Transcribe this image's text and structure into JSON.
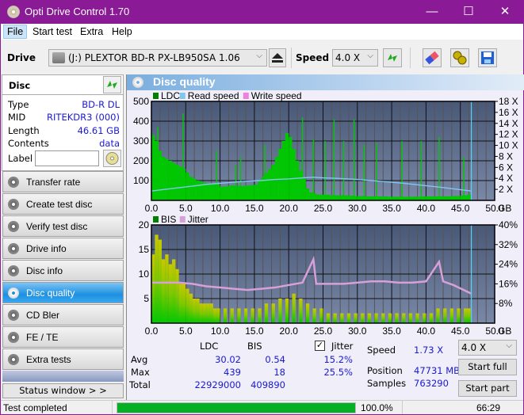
{
  "window": {
    "title": "Opti Drive Control 1.70",
    "minimize": "—",
    "maximize": "☐",
    "close": "✕"
  },
  "menu": [
    {
      "label": "File",
      "accel": "F"
    },
    {
      "label": "Start test",
      "accel": "S"
    },
    {
      "label": "Extra",
      "accel": "x"
    },
    {
      "label": "Help",
      "accel": "H"
    }
  ],
  "toolbar": {
    "drive_label": "Drive",
    "drive_value": "(J:)  PLEXTOR BD-R  PX-LB950SA 1.06",
    "speed_label": "Speed",
    "speed_value": "4.0 X",
    "icons": [
      "eject-icon",
      "refresh-icon",
      "eraser-icon",
      "settings-icon",
      "save-icon"
    ]
  },
  "disc": {
    "title": "Disc",
    "type_label": "Type",
    "type_value": "BD-R DL",
    "mid_label": "MID",
    "mid_value": "RITEKDR3 (000)",
    "length_label": "Length",
    "length_value": "46.61 GB",
    "contents_label": "Contents",
    "contents_value": "data",
    "label_label": "Label",
    "label_value": ""
  },
  "nav": [
    {
      "label": "Transfer rate",
      "selected": false
    },
    {
      "label": "Create test disc",
      "selected": false
    },
    {
      "label": "Verify test disc",
      "selected": false
    },
    {
      "label": "Drive info",
      "selected": false
    },
    {
      "label": "Disc info",
      "selected": false
    },
    {
      "label": "Disc quality",
      "selected": true
    },
    {
      "label": "CD Bler",
      "selected": false
    },
    {
      "label": "FE / TE",
      "selected": false
    },
    {
      "label": "Extra tests",
      "selected": false
    }
  ],
  "status_window_button": "Status window > >",
  "panel": {
    "title": "Disc quality"
  },
  "colors": {
    "ldc": "#00c800",
    "read_speed": "#7ec8f0",
    "write_speed": "#f080e0",
    "bis": "#00c800",
    "jitter": "#d8a0d8",
    "plot_bg_top": "#4a5878",
    "plot_bg_bottom": "#7a88a8",
    "accent": "#1e90e0"
  },
  "chart_data": [
    {
      "type": "bar",
      "title": "LDC / Read speed",
      "legend": [
        "LDC",
        "Read speed",
        "Write speed"
      ],
      "legend_position": "top-left",
      "xlabel": "GB",
      "x_ticks": [
        "0.0",
        "5.0",
        "10.0",
        "15.0",
        "20.0",
        "25.0",
        "30.0",
        "35.0",
        "40.0",
        "45.0",
        "50.0"
      ],
      "xlim": [
        0,
        50
      ],
      "y_left_ticks": [
        "100",
        "200",
        "300",
        "400",
        "500"
      ],
      "ylim_left": [
        0,
        500
      ],
      "y_right_ticks": [
        "2 X",
        "4 X",
        "6 X",
        "8 X",
        "10 X",
        "12 X",
        "14 X",
        "16 X",
        "18 X"
      ],
      "ylim_right": [
        0,
        18
      ],
      "grid": true,
      "end_marker_gb": 46.6,
      "series": [
        {
          "name": "LDC",
          "kind": "bar",
          "x": [
            0.5,
            1,
            1.5,
            2,
            2.5,
            3,
            3.5,
            4,
            4.5,
            5,
            5.5,
            6,
            6.5,
            7,
            7.5,
            8,
            8.5,
            9,
            9.5,
            10,
            10.5,
            11,
            11.5,
            12,
            12.5,
            13,
            13.5,
            14,
            14.5,
            15,
            15.5,
            16,
            16.5,
            17,
            17.5,
            18,
            18.5,
            19,
            19.5,
            20,
            20.5,
            21,
            21.5,
            22,
            22.5,
            23,
            23.5,
            24,
            24.5,
            25,
            25.5,
            26,
            26.5,
            27,
            27.5,
            28,
            28.5,
            29,
            29.5,
            30,
            30.5,
            31,
            31.5,
            32,
            32.5,
            33,
            33.5,
            34,
            34.5,
            35,
            35.5,
            36,
            36.5,
            37,
            37.5,
            38,
            38.5,
            39,
            39.5,
            40,
            40.5,
            41,
            41.5,
            42,
            42.5,
            43,
            43.5,
            44,
            44.5,
            45,
            45.5,
            46,
            46.5
          ],
          "values": [
            330,
            300,
            250,
            220,
            210,
            200,
            190,
            180,
            170,
            160,
            140,
            120,
            110,
            100,
            95,
            90,
            85,
            85,
            80,
            80,
            70,
            70,
            72,
            75,
            75,
            72,
            72,
            75,
            75,
            78,
            80,
            100,
            120,
            140,
            160,
            180,
            220,
            260,
            300,
            340,
            320,
            260,
            200,
            150,
            110,
            60,
            40,
            35,
            30,
            30,
            28,
            28,
            26,
            26,
            25,
            25,
            25,
            24,
            24,
            22,
            22,
            22,
            20,
            20,
            20,
            20,
            20,
            20,
            20,
            18,
            18,
            18,
            18,
            18,
            18,
            18,
            18,
            18,
            18,
            20,
            20,
            20,
            20,
            20,
            20,
            20,
            20,
            22,
            22,
            22,
            25,
            25,
            30
          ]
        },
        {
          "name": "LDC spikes",
          "kind": "bar",
          "x": [
            0.9,
            4.6,
            9.5,
            12.3,
            13.0,
            16.5,
            22.0,
            23.6,
            25.3,
            26.6,
            28.0,
            29.5,
            31.0,
            32.8,
            36.5,
            39.3,
            41.9,
            45.5
          ],
          "values": [
            370,
            439,
            250,
            180,
            220,
            280,
            420,
            310,
            300,
            410,
            300,
            410,
            280,
            290,
            300,
            300,
            320,
            220
          ]
        },
        {
          "name": "Read speed",
          "kind": "line",
          "axis": "right",
          "x": [
            0,
            2,
            4,
            6,
            8,
            10,
            12,
            14,
            16,
            18,
            20,
            22,
            23.6,
            25,
            27,
            30,
            33,
            36,
            39,
            42,
            44,
            46.6
          ],
          "values": [
            1.7,
            2.0,
            2.3,
            2.6,
            2.9,
            3.1,
            3.3,
            3.5,
            3.6,
            3.8,
            3.9,
            4.1,
            4.2,
            4.1,
            4.0,
            3.8,
            3.5,
            3.2,
            2.8,
            2.4,
            2.1,
            1.7
          ]
        }
      ]
    },
    {
      "type": "bar",
      "title": "BIS / Jitter",
      "legend": [
        "BIS",
        "Jitter"
      ],
      "legend_position": "top-left",
      "xlabel": "GB",
      "x_ticks": [
        "0.0",
        "5.0",
        "10.0",
        "15.0",
        "20.0",
        "25.0",
        "30.0",
        "35.0",
        "40.0",
        "45.0",
        "50.0"
      ],
      "xlim": [
        0,
        50
      ],
      "y_left_ticks": [
        "5",
        "10",
        "15",
        "20"
      ],
      "ylim_left": [
        0,
        20
      ],
      "y_right_ticks": [
        "8%",
        "16%",
        "24%",
        "32%",
        "40%"
      ],
      "ylim_right": [
        0,
        40
      ],
      "grid": true,
      "end_marker_gb": 46.6,
      "series": [
        {
          "name": "BIS",
          "kind": "bar",
          "x": [
            0.5,
            1,
            1.5,
            2,
            2.5,
            3,
            3.5,
            4,
            4.5,
            5,
            5.5,
            6,
            6.5,
            7,
            7.5,
            8,
            8.5,
            9,
            9.5,
            10,
            11,
            12,
            13,
            14,
            15,
            16,
            17,
            18,
            19,
            20,
            21,
            22,
            23,
            24,
            25,
            26,
            27,
            28,
            29,
            30,
            31,
            32,
            33,
            34,
            35,
            36,
            37,
            38,
            39,
            40,
            41,
            42,
            43,
            44,
            45,
            46,
            46.5
          ],
          "values": [
            14,
            18,
            17,
            13,
            14,
            12,
            13,
            11,
            8,
            8,
            7,
            6,
            5,
            5,
            4,
            4,
            4,
            4,
            3,
            3,
            3,
            3,
            3,
            3,
            3,
            3,
            4,
            4,
            5,
            5,
            6,
            5,
            4,
            3,
            3,
            2,
            2,
            2,
            2,
            2,
            2,
            2,
            2,
            2,
            2,
            2,
            2,
            2,
            2,
            2,
            2,
            3,
            3,
            3,
            3,
            3,
            3
          ]
        },
        {
          "name": "Jitter",
          "kind": "line",
          "axis": "right",
          "x": [
            0,
            2,
            4,
            6,
            8,
            10,
            12,
            14,
            16,
            18,
            20,
            22,
            23.6,
            24,
            26,
            28,
            30,
            32,
            34,
            36,
            38,
            40,
            41.9,
            42.5,
            44,
            46.6
          ],
          "values": [
            16.5,
            16.5,
            16.5,
            16,
            15,
            14.5,
            14,
            13.5,
            14,
            14.5,
            15.5,
            16.5,
            26,
            16,
            16,
            16,
            16.5,
            17,
            17,
            16.5,
            16.5,
            17,
            25,
            17,
            15.5,
            12
          ]
        }
      ]
    }
  ],
  "stats": {
    "col_ldc": "LDC",
    "col_bis": "BIS",
    "avg_label": "Avg",
    "max_label": "Max",
    "total_label": "Total",
    "ldc_avg": "30.02",
    "ldc_max": "439",
    "ldc_total": "22929000",
    "bis_avg": "0.54",
    "bis_max": "18",
    "bis_total": "409890",
    "jitter_checked": true,
    "jitter_label": "Jitter",
    "jitter_avg": "15.2%",
    "jitter_max": "25.5%",
    "speed_label": "Speed",
    "speed_value": "1.73 X",
    "position_label": "Position",
    "position_value": "47731 MB",
    "samples_label": "Samples",
    "samples_value": "763290",
    "speed_select": "4.0 X",
    "start_full": "Start full",
    "start_part": "Start part"
  },
  "statusbar": {
    "text": "Test completed",
    "progress": 100.0,
    "progress_text": "100.0%",
    "time": "66:29"
  }
}
